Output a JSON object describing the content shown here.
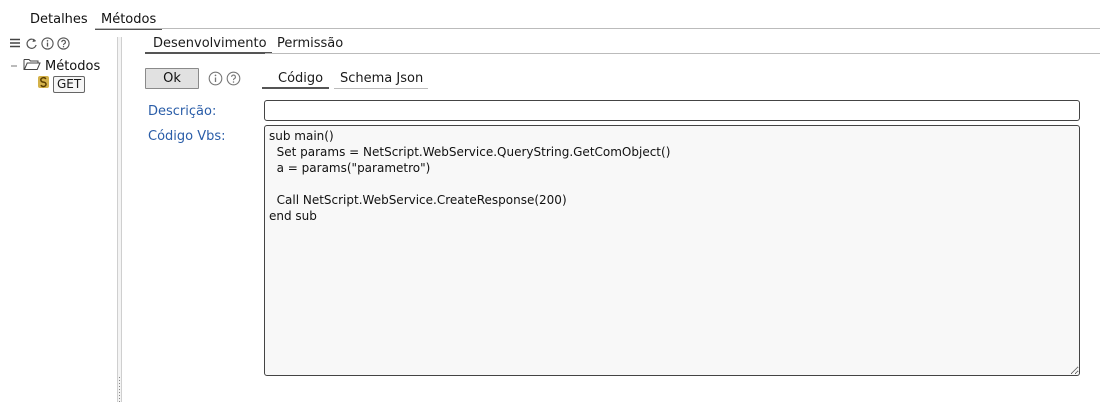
{
  "top_tabs": {
    "detalhes": "Detalhes",
    "metodos": "Métodos"
  },
  "tree_toolbar": {
    "icons": [
      "menu-icon",
      "refresh-icon",
      "info-icon",
      "help-icon"
    ]
  },
  "tree": {
    "root_label": "Métodos",
    "child_label": "GET",
    "icons": [
      "collapse-icon",
      "folder-open-icon",
      "script-icon"
    ]
  },
  "sub_tabs": {
    "desenvolvimento": "Desenvolvimento",
    "permissao": "Permissão"
  },
  "toolbar": {
    "ok_label": "Ok"
  },
  "code_tabs": {
    "codigo": "Código",
    "schema_json": "Schema Json"
  },
  "form": {
    "descricao_label": "Descrição:",
    "descricao_value": "",
    "codigo_label": "Código Vbs:",
    "codigo_value": "sub main()\n  Set params = NetScript.WebService.QueryString.GetComObject()\n  a = params(\"parametro\")\n\n  Call NetScript.WebService.CreateResponse(200)\nend sub"
  },
  "colors": {
    "label_blue": "#2a5da8",
    "tab_underline": "#555555",
    "button_bg": "#e1e1e1",
    "code_bg": "#f8f8f8"
  }
}
